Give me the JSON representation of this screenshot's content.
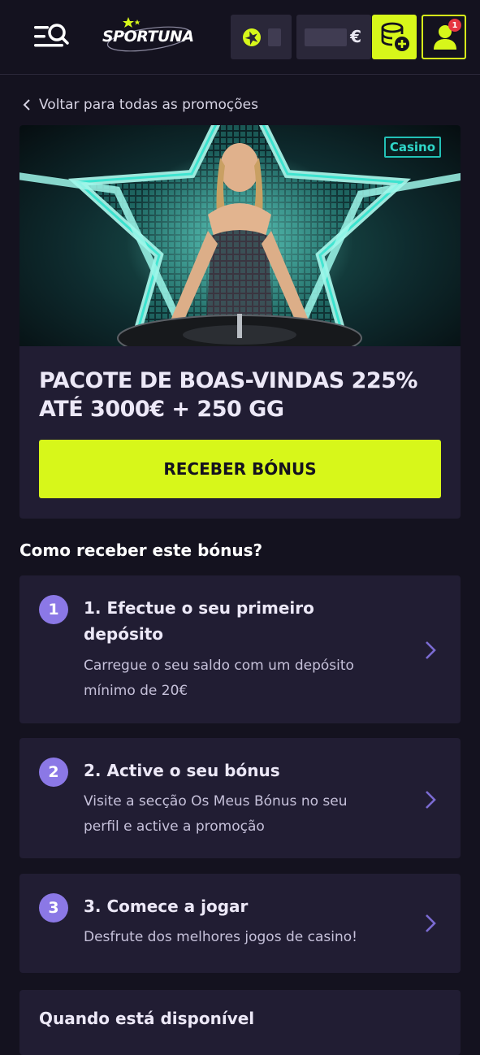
{
  "header": {
    "logo_text": "SPORTUNA",
    "balance_currency": "€",
    "notification_count": "1"
  },
  "back_link": {
    "label": "Voltar para todas as promoções"
  },
  "promo": {
    "category_tag": "Casino",
    "title_line1": "PACOTE DE BOAS-VINDAS 225%",
    "title_line2": "ATÉ 3000€ + 250 GG",
    "cta_label": "RECEBER BÓNUS"
  },
  "how_to": {
    "heading": "Como receber este bónus?",
    "steps": [
      {
        "number": "1",
        "title_line1": "1. Efectue o seu primeiro",
        "title_line2": "depósito",
        "desc_line1": "Carregue o seu saldo com um depósito",
        "desc_line2": "mínimo de 20€"
      },
      {
        "number": "2",
        "title_line1": "2. Active o seu bónus",
        "desc_line1": "Visite a secção Os Meus Bónus no seu",
        "desc_line2": "perfil e active a promoção"
      },
      {
        "number": "3",
        "title_line1": "3. Comece a jogar",
        "desc_line1": "Desfrute dos melhores jogos de casino!"
      }
    ]
  },
  "availability": {
    "heading": "Quando está disponível"
  },
  "colors": {
    "background": "#14121f",
    "card": "#211d33",
    "accent": "#d7f71a",
    "step_badge": "#8b78e6",
    "tag_teal": "#22c1b6",
    "badge_red": "#e63642"
  }
}
